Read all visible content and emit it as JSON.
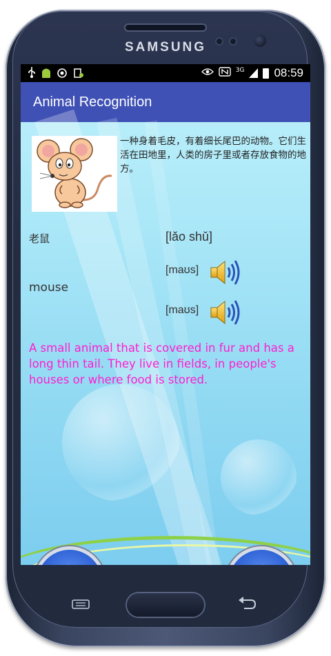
{
  "device": {
    "brand": "SAMSUNG"
  },
  "statusbar": {
    "left_icons": [
      "usb-icon",
      "android-icon",
      "sync-icon",
      "notification-icon"
    ],
    "right_icons": [
      "eye-icon",
      "nfc-icon",
      "network-3g-icon",
      "signal-icon",
      "battery-icon"
    ],
    "network_label": "3G",
    "time": "08:59"
  },
  "appbar": {
    "title": "Animal Recognition",
    "color": "#3f51b5"
  },
  "animal": {
    "image": "mouse-illustration",
    "cn_description": "一种身着毛皮，有着细长尾巴的动物。它们生活在田地里，人类的房子里或者存放食物的地方。",
    "cn_word": "老鼠",
    "pinyin": "[lǎo shǔ]",
    "en_word": "mouse",
    "phonetic_1": "[maʊs]",
    "phonetic_2": "[maʊs]",
    "en_description": "A small animal that is covered in fur and has a long thin tail. They live in fields, in people's houses or where food is stored.",
    "en_description_color": "#ff1dd1"
  },
  "navigation": {
    "prev_icon": "arrow-left-icon",
    "next_icon": "arrow-right-icon"
  },
  "hardware_keys": [
    "menu-key",
    "home-key",
    "back-key"
  ]
}
